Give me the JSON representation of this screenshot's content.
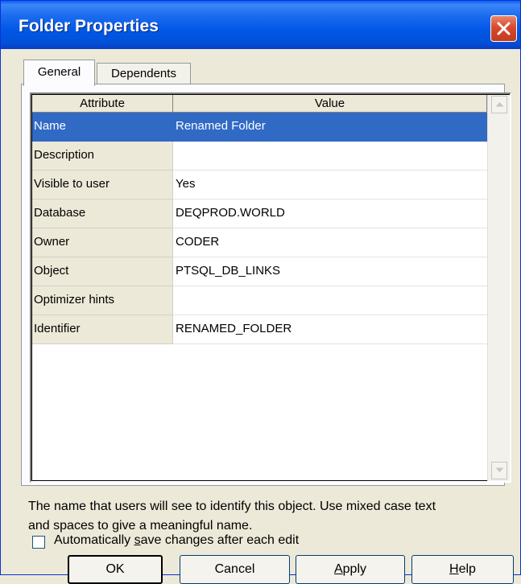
{
  "window": {
    "title": "Folder Properties"
  },
  "tabs": [
    {
      "label": "General",
      "active": true
    },
    {
      "label": "Dependents",
      "active": false
    }
  ],
  "grid": {
    "columns": [
      "Attribute",
      "Value"
    ],
    "rows": [
      {
        "attribute": "Name",
        "value": "Renamed Folder",
        "selected": true
      },
      {
        "attribute": "Description",
        "value": ""
      },
      {
        "attribute": "Visible to user",
        "value": "Yes"
      },
      {
        "attribute": "Database",
        "value": "DEQPROD.WORLD"
      },
      {
        "attribute": "Owner",
        "value": "CODER"
      },
      {
        "attribute": "Object",
        "value": "PTSQL_DB_LINKS"
      },
      {
        "attribute": "Optimizer hints",
        "value": ""
      },
      {
        "attribute": "Identifier",
        "value": "RENAMED_FOLDER"
      }
    ]
  },
  "description": {
    "line1": "The name that users will see to identify this object. Use mixed case text",
    "line2": "and spaces to give a meaningful name."
  },
  "autosave": {
    "label_pre": "Automatically ",
    "label_accel": "s",
    "label_post": "ave changes after each edit",
    "checked": false
  },
  "buttons": {
    "ok": "OK",
    "cancel": "Cancel",
    "apply_accel": "A",
    "apply_rest": "pply",
    "help_accel": "H",
    "help_rest": "elp"
  },
  "icons": {
    "close": "close-icon",
    "scroll_up": "scroll-up-arrow-icon",
    "scroll_down": "scroll-down-arrow-icon"
  },
  "colors": {
    "titlebar": "#0058e6",
    "selection": "#316ac5",
    "face": "#ece9d8",
    "close_button": "#d9492c"
  }
}
